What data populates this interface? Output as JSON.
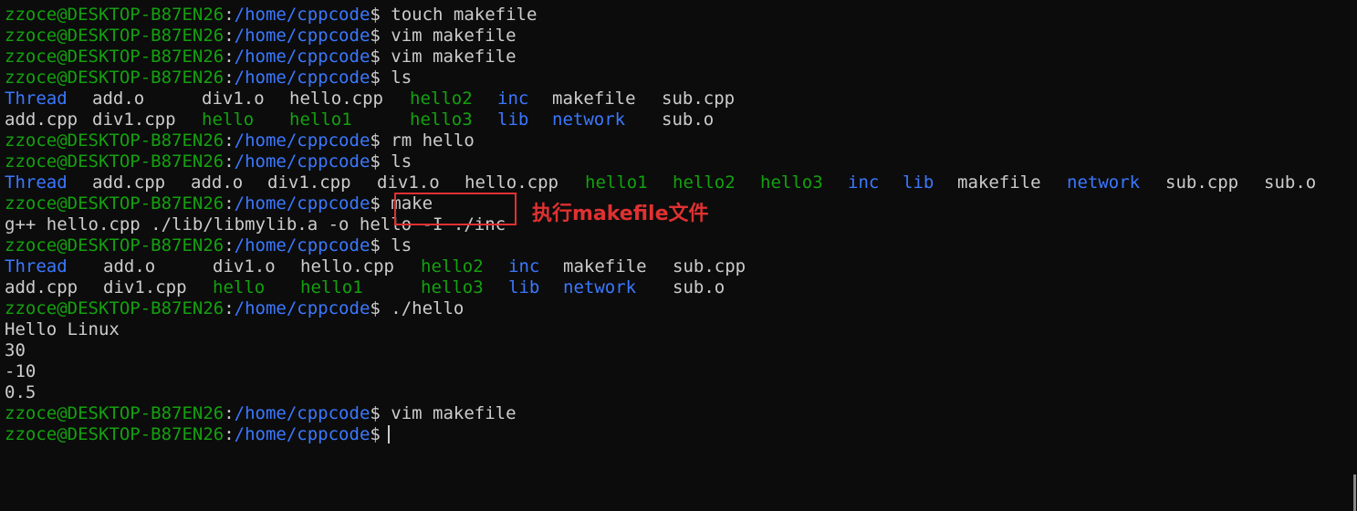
{
  "prompt": {
    "user": "zzoce@DESKTOP-B87EN26",
    "sep": ":",
    "path": "/home/cppcode",
    "sym": "$"
  },
  "commands": {
    "c1": " touch makefile",
    "c2": " vim makefile",
    "c3": " vim makefile",
    "c4": " ls",
    "c5": " rm hello",
    "c6": " ls",
    "c7": " make",
    "c8": " ls",
    "c9": " ./hello",
    "c10": " vim makefile"
  },
  "ls1": {
    "row1": [
      "Thread",
      "add.o",
      "div1.o",
      "hello.cpp",
      "hello2",
      "inc",
      "makefile",
      "sub.cpp"
    ],
    "row2": [
      "add.cpp",
      "div1.cpp",
      "hello",
      "hello1",
      "hello3",
      "lib",
      "network",
      "sub.o"
    ]
  },
  "ls2": {
    "row1": [
      "Thread",
      "add.cpp",
      "add.o",
      "div1.cpp",
      "div1.o",
      "hello.cpp",
      "hello1",
      "hello2",
      "hello3",
      "inc",
      "lib",
      "makefile",
      "network",
      "sub.cpp",
      "sub.o"
    ]
  },
  "ls3": {
    "row1": [
      "Thread",
      "add.o",
      "div1.o",
      "hello.cpp",
      "hello2",
      "inc",
      "makefile",
      "sub.cpp"
    ],
    "row2": [
      "add.cpp",
      "div1.cpp",
      "hello",
      "hello1",
      "hello3",
      "lib",
      "network",
      "sub.o"
    ]
  },
  "make_output": "g++ hello.cpp ./lib/libmylib.a -o hello -I ./inc",
  "program_output": [
    "Hello Linux",
    "30",
    "-10",
    "0.5"
  ],
  "annotation": {
    "text": "执行makefile文件"
  },
  "colors": {
    "background": "#0c0c0c",
    "prompt_user": "#13a10e",
    "prompt_path": "#3b78ff",
    "text": "#cccccc",
    "directory": "#3b78ff",
    "executable": "#13a10e",
    "annotation": "#e03131"
  }
}
